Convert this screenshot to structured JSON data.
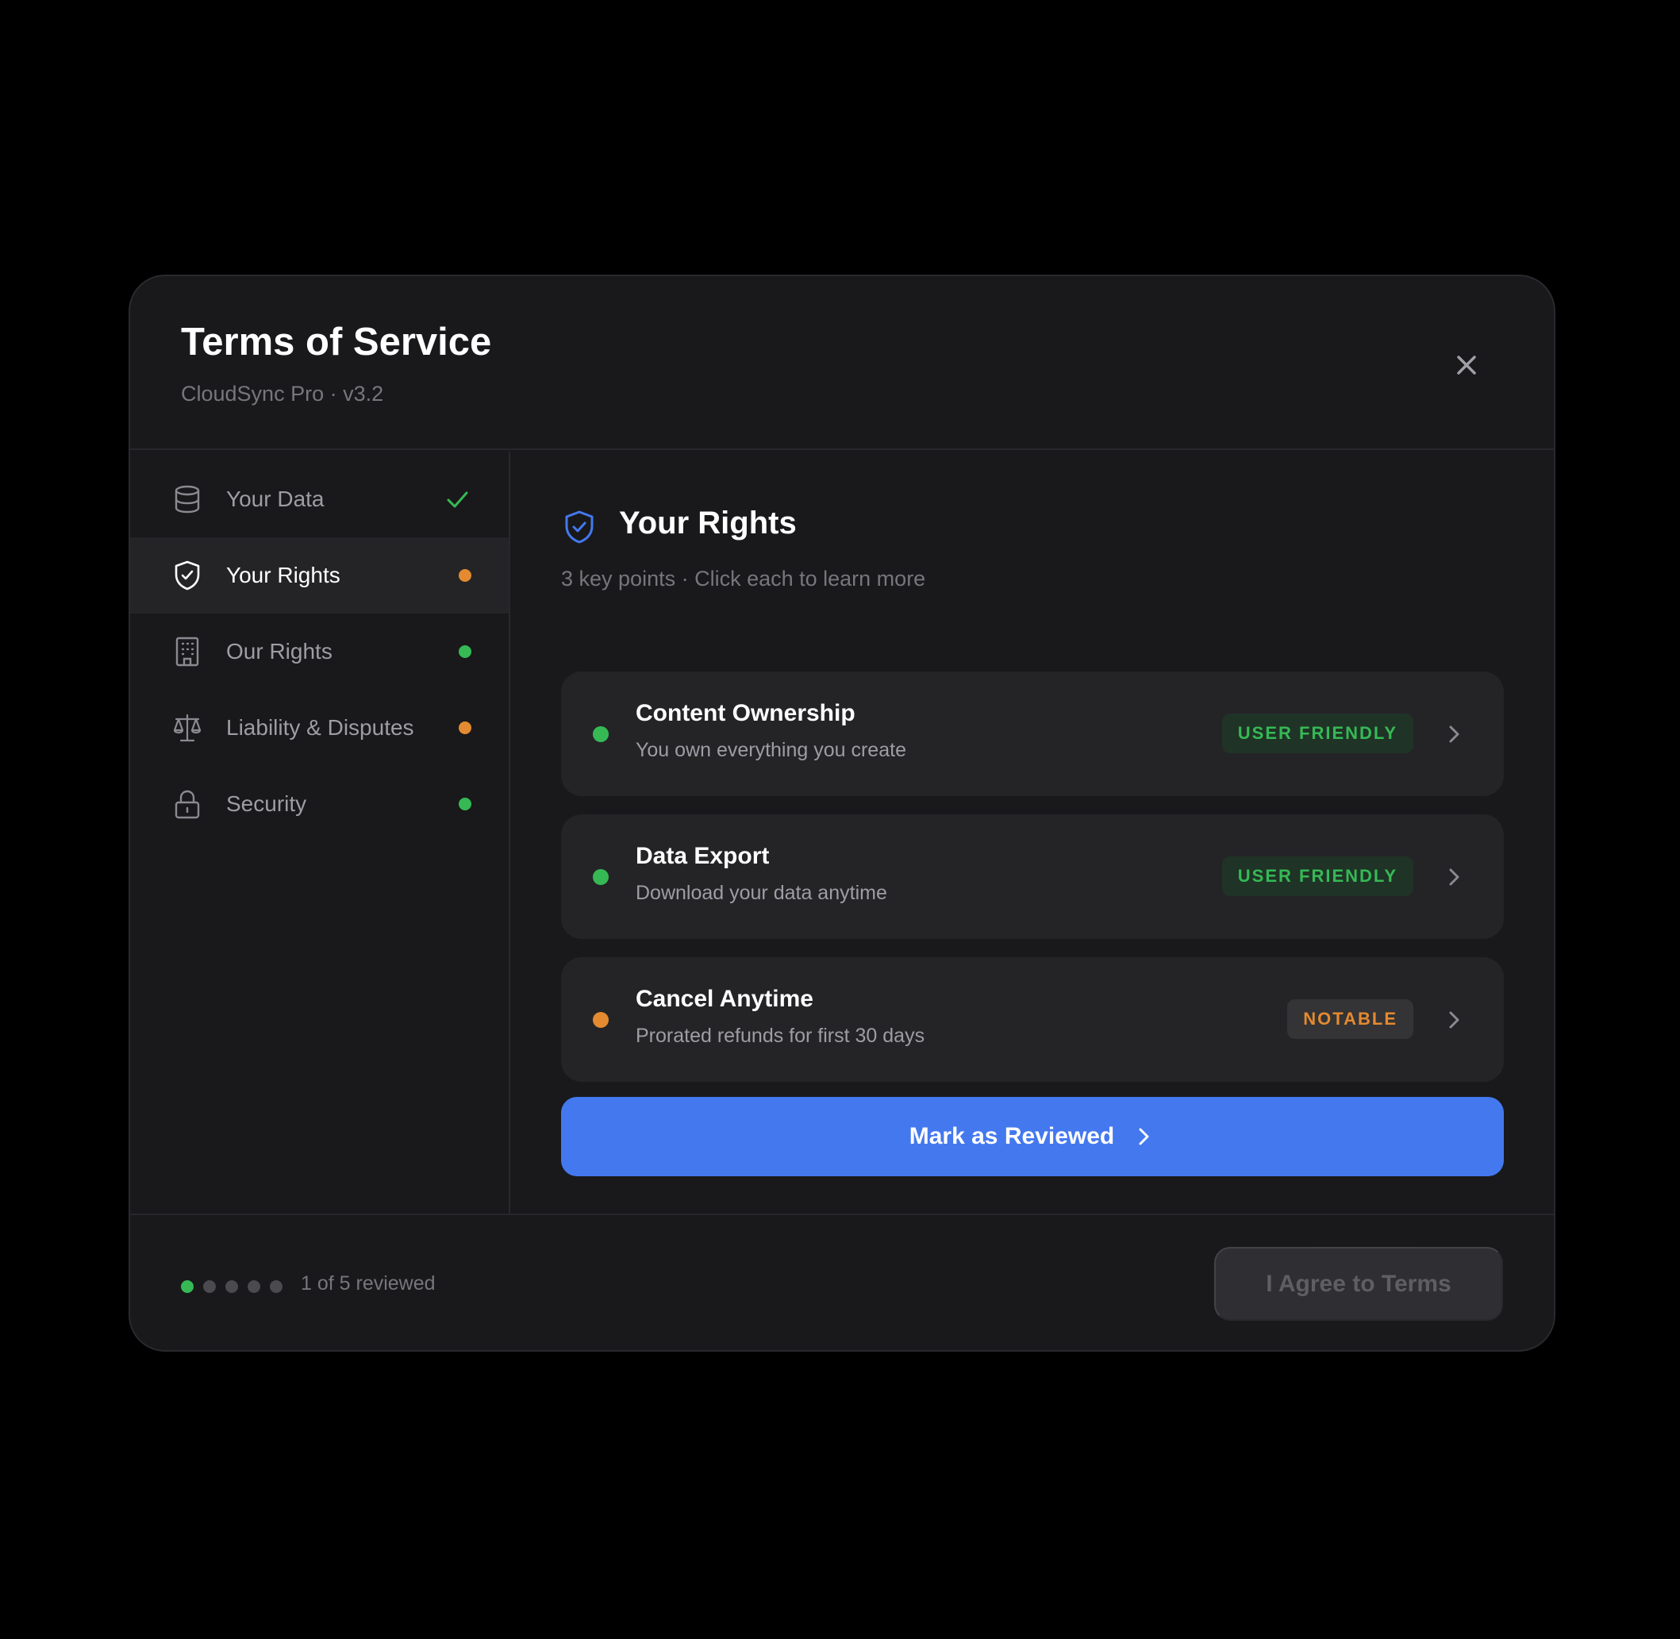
{
  "header": {
    "title": "Terms of Service",
    "subtitle": "CloudSync Pro · v3.2"
  },
  "sidebar": {
    "items": [
      {
        "label": "Your Data",
        "icon": "database-icon",
        "status": "reviewed",
        "active": false
      },
      {
        "label": "Your Rights",
        "icon": "shield-check-icon",
        "status": "notable",
        "active": true
      },
      {
        "label": "Our Rights",
        "icon": "building-icon",
        "status": "user-friendly",
        "active": false
      },
      {
        "label": "Liability & Disputes",
        "icon": "scale-icon",
        "status": "notable",
        "active": false
      },
      {
        "label": "Security",
        "icon": "lock-icon",
        "status": "user-friendly",
        "active": false
      }
    ]
  },
  "section": {
    "title": "Your Rights",
    "icon": "shield-check-icon",
    "subtitle": "3 key points · Click each to learn more",
    "points": [
      {
        "title": "Content Ownership",
        "description": "You own everything you create",
        "badge": "USER FRIENDLY",
        "level": "friendly"
      },
      {
        "title": "Data Export",
        "description": "Download your data anytime",
        "badge": "USER FRIENDLY",
        "level": "friendly"
      },
      {
        "title": "Cancel Anytime",
        "description": "Prorated refunds for first 30 days",
        "badge": "NOTABLE",
        "level": "notable"
      }
    ],
    "action_label": "Mark as Reviewed"
  },
  "footer": {
    "progress_text": "1 of 5 reviewed",
    "reviewed_count": 1,
    "total_count": 5,
    "agree_label": "I Agree to Terms"
  },
  "colors": {
    "accent": "#4478ef",
    "friendly": "#36b955",
    "notable": "#e48a30",
    "background": "#000000",
    "surface": "#19191b"
  }
}
